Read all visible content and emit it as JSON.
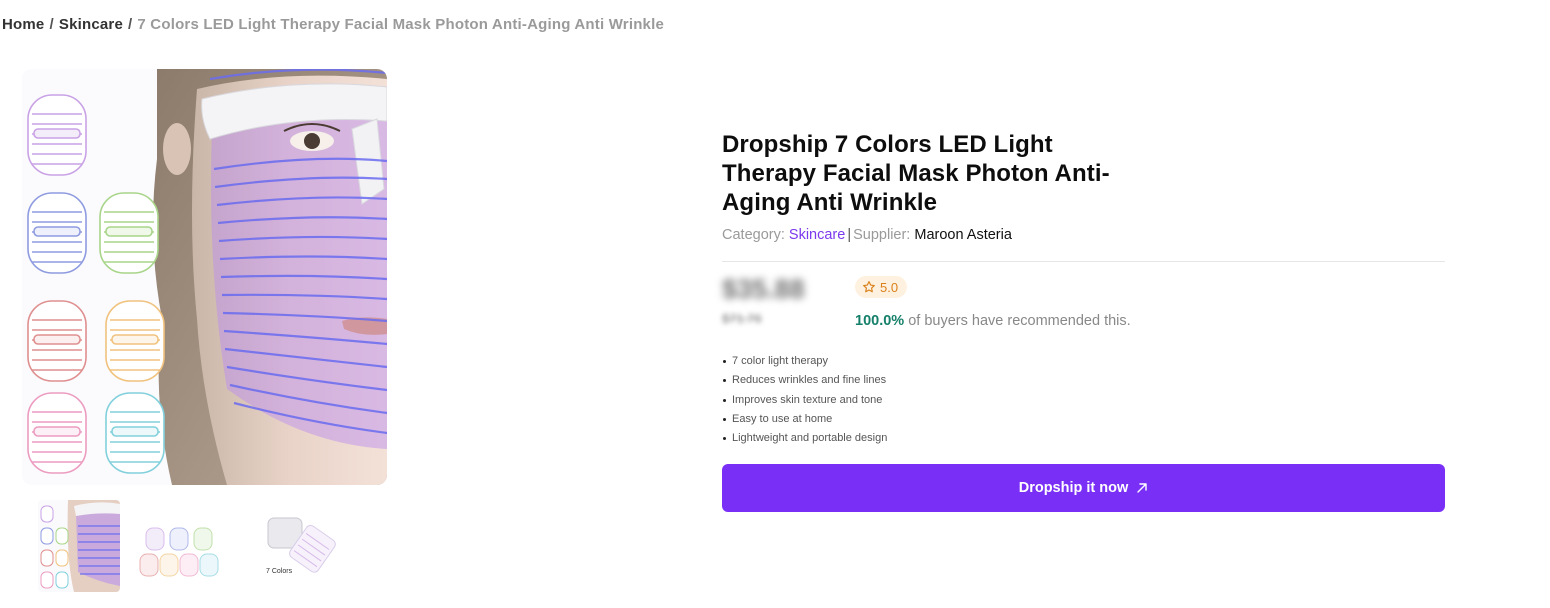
{
  "breadcrumb": {
    "home": "Home",
    "separator": "/",
    "category": "Skincare",
    "current": "7 Colors LED Light Therapy Facial Mask Photon Anti-Aging Anti Wrinkle"
  },
  "gallery": {
    "thumbnails": [
      {
        "icon": "product-thumbnail-model"
      },
      {
        "icon": "product-thumbnail-color-grid"
      },
      {
        "icon": "product-thumbnail-box",
        "caption": "7 Colors"
      }
    ]
  },
  "product": {
    "title": "Dropship 7 Colors LED Light Therapy Facial Mask Photon Anti-Aging Anti Wrinkle",
    "category_label": "Category:",
    "category": "Skincare",
    "supplier_separator": "|",
    "supplier_label": "Supplier:",
    "supplier": "Maroon Asteria",
    "price": "$35.88",
    "original_price": "$71.76",
    "rating": "5.0",
    "recommend_pct": "100.0%",
    "recommend_text": "of buyers have recommended this.",
    "features": [
      "7 color light therapy",
      "Reduces wrinkles and fine lines",
      "Improves skin texture and tone",
      "Easy to use at home",
      "Lightweight and portable design"
    ],
    "cta_label": "Dropship it now"
  },
  "colors": {
    "accent": "#7a2ff7",
    "category_link": "#7c3aed",
    "rating_bg": "#fff1df",
    "rating_fg": "#d9801a",
    "recommend_pct": "#15806a"
  }
}
